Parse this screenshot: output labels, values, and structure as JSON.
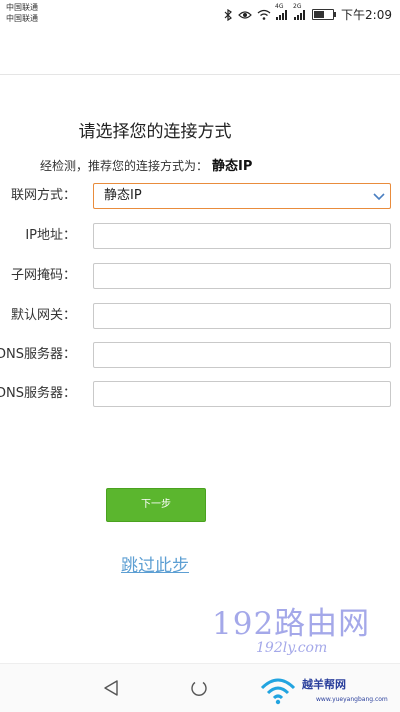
{
  "status_bar": {
    "carrier_1": "中国联通",
    "carrier_2": "中国联通",
    "network_1": "4G",
    "network_2": "2G",
    "time": "下午2:09",
    "battery_level": 0.55,
    "icons": [
      "bluetooth-icon",
      "eye-icon",
      "wifi-icon",
      "signal-icon",
      "signal-icon",
      "battery-icon"
    ]
  },
  "page": {
    "title": "请选择您的连接方式",
    "hint_prefix": "经检测，推荐您的连接方式为：",
    "hint_value": "静态IP"
  },
  "form": {
    "connection_type": {
      "label": "联网方式：",
      "value": "静态IP"
    },
    "ip_address": {
      "label": "IP地址：",
      "value": ""
    },
    "subnet_mask": {
      "label": "子网掩码：",
      "value": ""
    },
    "default_gateway": {
      "label": "默认网关：",
      "value": ""
    },
    "primary_dns": {
      "label": "DNS服务器：",
      "value": ""
    },
    "secondary_dns": {
      "label": "DNS服务器：",
      "value": ""
    }
  },
  "actions": {
    "next_label": "下一步",
    "skip_label": "跳过此步"
  },
  "watermark": {
    "text": "192路由网",
    "url": "192ly.com"
  },
  "branding": {
    "name": "越羊帮网",
    "url": "www.yueyangbang.com"
  },
  "colors": {
    "accent_green": "#5bb62e",
    "select_border": "#e98c3c",
    "link_blue": "#5d9fd3",
    "watermark_purple": "#5a62d8",
    "brand_blue": "#2a3f9c"
  }
}
